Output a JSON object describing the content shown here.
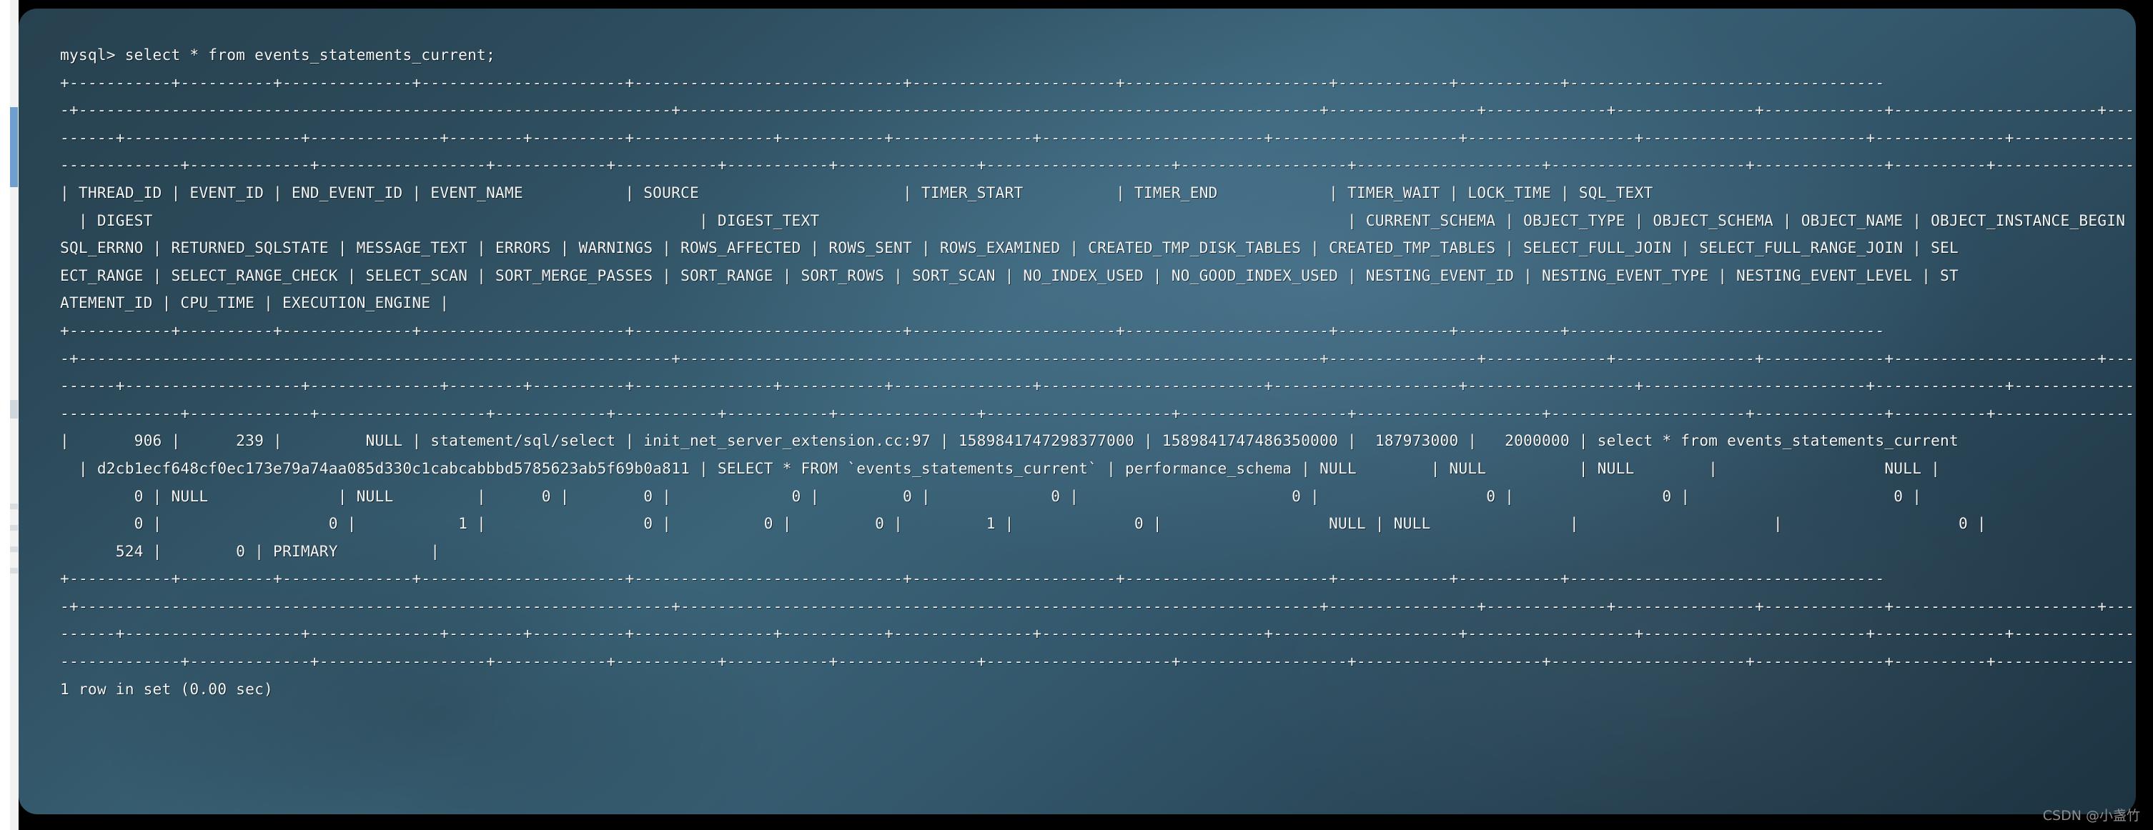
{
  "window": {
    "type": "terminal",
    "background_color": "#2f5164",
    "text_color": "#f4f7f8",
    "page_background": "#000000"
  },
  "terminal": {
    "prompt_line": "mysql> select * from events_statements_current;",
    "lines": [
      "mysql> select * from events_statements_current;",
      "+-----------+----------+--------------+----------------------+-----------------------------+----------------------+----------------------+------------+-----------+----------------------------------",
      "-+----------------------------------------------------------------+---------------------------------------------------------------------+----------------+-------------+---------------+-------------+----------------------+-----",
      "------+-------------------+--------------+--------+----------+---------------+-----------+---------------+------------------------+--------------------+------------------+------------------------+--------------+---------------------+-",
      "-------------+-------------+------------------+------------+-----------+-----------+---------------+--------------------+------------------+--------------------+---------------------+--------------+----------+------------------+",
      "| THREAD_ID | EVENT_ID | END_EVENT_ID | EVENT_NAME           | SOURCE                      | TIMER_START          | TIMER_END            | TIMER_WAIT | LOCK_TIME | SQL_TEXT",
      "  | DIGEST                                                           | DIGEST_TEXT                                                         | CURRENT_SCHEMA | OBJECT_TYPE | OBJECT_SCHEMA | OBJECT_NAME | OBJECT_INSTANCE_BEGIN | MY",
      "SQL_ERRNO | RETURNED_SQLSTATE | MESSAGE_TEXT | ERRORS | WARNINGS | ROWS_AFFECTED | ROWS_SENT | ROWS_EXAMINED | CREATED_TMP_DISK_TABLES | CREATED_TMP_TABLES | SELECT_FULL_JOIN | SELECT_FULL_RANGE_JOIN | SEL",
      "ECT_RANGE | SELECT_RANGE_CHECK | SELECT_SCAN | SORT_MERGE_PASSES | SORT_RANGE | SORT_ROWS | SORT_SCAN | NO_INDEX_USED | NO_GOOD_INDEX_USED | NESTING_EVENT_ID | NESTING_EVENT_TYPE | NESTING_EVENT_LEVEL | ST",
      "ATEMENT_ID | CPU_TIME | EXECUTION_ENGINE |",
      "+-----------+----------+--------------+----------------------+-----------------------------+----------------------+----------------------+------------+-----------+----------------------------------",
      "-+----------------------------------------------------------------+---------------------------------------------------------------------+----------------+-------------+---------------+-------------+----------------------+-----",
      "------+-------------------+--------------+--------+----------+---------------+-----------+---------------+------------------------+--------------------+------------------+------------------------+--------------+---------------------+-",
      "-------------+-------------+------------------+------------+-----------+-----------+---------------+--------------------+------------------+--------------------+---------------------+--------------+----------+------------------+",
      "|       906 |      239 |         NULL | statement/sql/select | init_net_server_extension.cc:97 | 1589841747298377000 | 1589841747486350000 |  187973000 |   2000000 | select * from events_statements_current",
      "  | d2cb1ecf648cf0ec173e79a74aa085d330c1cabcabbbd5785623ab5f69b0a811 | SELECT * FROM `events_statements_current` | performance_schema | NULL        | NULL          | NULL        |                  NULL |",
      "        0 | NULL              | NULL         |      0 |        0 |             0 |         0 |             0 |                       0 |                  0 |                0 |                      0 |",
      "        0 |                  0 |           1 |                 0 |          0 |         0 |         1 |             0 |                  NULL | NULL               |                     |                   0 |",
      "      524 |        0 | PRIMARY          |",
      "+-----------+----------+--------------+----------------------+-----------------------------+----------------------+----------------------+------------+-----------+----------------------------------",
      "-+----------------------------------------------------------------+---------------------------------------------------------------------+----------------+-------------+---------------+-------------+----------------------+-----",
      "------+-------------------+--------------+--------+----------+---------------+-----------+---------------+------------------------+--------------------+------------------+------------------------+--------------+---------------------+-",
      "-------------+-------------+------------------+------------+-----------+-----------+---------------+--------------------+------------------+--------------------+---------------------+--------------+----------+------------------+",
      "1 row in set (0.00 sec)"
    ],
    "query": {
      "statement": "select * from events_statements_current;",
      "table": "events_statements_current",
      "prompt": "mysql>"
    },
    "result_table": {
      "columns": [
        "THREAD_ID",
        "EVENT_ID",
        "END_EVENT_ID",
        "EVENT_NAME",
        "SOURCE",
        "TIMER_START",
        "TIMER_END",
        "TIMER_WAIT",
        "LOCK_TIME",
        "SQL_TEXT",
        "DIGEST",
        "DIGEST_TEXT",
        "CURRENT_SCHEMA",
        "OBJECT_TYPE",
        "OBJECT_SCHEMA",
        "OBJECT_NAME",
        "OBJECT_INSTANCE_BEGIN",
        "MYSQL_ERRNO",
        "RETURNED_SQLSTATE",
        "MESSAGE_TEXT",
        "ERRORS",
        "WARNINGS",
        "ROWS_AFFECTED",
        "ROWS_SENT",
        "ROWS_EXAMINED",
        "CREATED_TMP_DISK_TABLES",
        "CREATED_TMP_TABLES",
        "SELECT_FULL_JOIN",
        "SELECT_FULL_RANGE_JOIN",
        "SELECT_RANGE",
        "SELECT_RANGE_CHECK",
        "SELECT_SCAN",
        "SORT_MERGE_PASSES",
        "SORT_RANGE",
        "SORT_ROWS",
        "SORT_SCAN",
        "NO_INDEX_USED",
        "NO_GOOD_INDEX_USED",
        "NESTING_EVENT_ID",
        "NESTING_EVENT_TYPE",
        "NESTING_EVENT_LEVEL",
        "STATEMENT_ID",
        "CPU_TIME",
        "EXECUTION_ENGINE"
      ],
      "row": {
        "THREAD_ID": "906",
        "EVENT_ID": "239",
        "END_EVENT_ID": "NULL",
        "EVENT_NAME": "statement/sql/select",
        "SOURCE": "init_net_server_extension.cc:97",
        "TIMER_START": "1589841747298377000",
        "TIMER_END": "1589841747486350000",
        "TIMER_WAIT": "187973000",
        "LOCK_TIME": "2000000",
        "SQL_TEXT": "select * from events_statements_current",
        "DIGEST": "d2cb1ecf648cf0ec173e79a74aa085d330c1cabcabbbd5785623ab5f69b0a811",
        "DIGEST_TEXT": "SELECT * FROM `events_statements_current`",
        "CURRENT_SCHEMA": "performance_schema",
        "OBJECT_TYPE": "NULL",
        "OBJECT_SCHEMA": "NULL",
        "OBJECT_NAME": "NULL",
        "OBJECT_INSTANCE_BEGIN": "NULL",
        "MYSQL_ERRNO": "0",
        "RETURNED_SQLSTATE": "NULL",
        "MESSAGE_TEXT": "NULL",
        "ERRORS": "0",
        "WARNINGS": "0",
        "ROWS_AFFECTED": "0",
        "ROWS_SENT": "0",
        "ROWS_EXAMINED": "0",
        "CREATED_TMP_DISK_TABLES": "0",
        "CREATED_TMP_TABLES": "0",
        "SELECT_FULL_JOIN": "0",
        "SELECT_FULL_RANGE_JOIN": "0",
        "SELECT_RANGE": "0",
        "SELECT_RANGE_CHECK": "0",
        "SELECT_SCAN": "1",
        "SORT_MERGE_PASSES": "0",
        "SORT_RANGE": "0",
        "SORT_ROWS": "0",
        "SORT_SCAN": "1",
        "NO_INDEX_USED": "0",
        "NO_GOOD_INDEX_USED": "NULL",
        "NESTING_EVENT_ID": "NULL",
        "NESTING_EVENT_TYPE": "",
        "NESTING_EVENT_LEVEL": "0",
        "STATEMENT_ID": "524",
        "CPU_TIME": "0",
        "EXECUTION_ENGINE": "PRIMARY"
      }
    },
    "status_line": "1 row in set (0.00 sec)"
  },
  "watermark": {
    "text": "CSDN @小盏竹"
  }
}
